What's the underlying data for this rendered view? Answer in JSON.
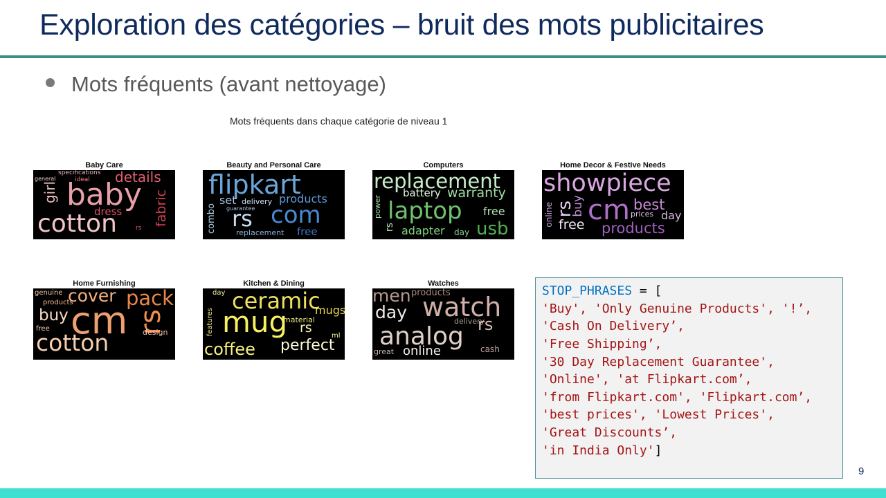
{
  "slide": {
    "title": "Exploration des catégories – bruit des mots publicitaires",
    "bullet": "Mots fréquents (avant nettoyage)",
    "figure_title": "Mots fréquents dans chaque catégorie de niveau 1",
    "page_number": "9"
  },
  "categories": [
    {
      "label": "Baby Care",
      "words": [
        "baby",
        "cotton",
        "details",
        "girl",
        "fabric",
        "dress",
        "specifications",
        "ideal",
        "general",
        "rs"
      ]
    },
    {
      "label": "Beauty and Personal Care",
      "words": [
        "flipkart",
        "rs",
        "com",
        "products",
        "set",
        "delivery",
        "guarantee",
        "combo",
        "replacement",
        "free"
      ]
    },
    {
      "label": "Computers",
      "words": [
        "replacement",
        "laptop",
        "battery",
        "warranty",
        "free",
        "usb",
        "adapter",
        "day",
        "power",
        "rs"
      ]
    },
    {
      "label": "Home Decor & Festive Needs",
      "words": [
        "showpiece",
        "cm",
        "rs",
        "buy",
        "online",
        "best",
        "prices",
        "day",
        "free",
        "products"
      ]
    },
    {
      "label": "Home Furnishing",
      "words": [
        "cm",
        "cover",
        "pack",
        "cotton",
        "buy",
        "rs",
        "genuine",
        "products",
        "free",
        "design"
      ]
    },
    {
      "label": "Kitchen & Dining",
      "words": [
        "ceramic",
        "mug",
        "coffee",
        "mugs",
        "material",
        "rs",
        "perfect",
        "features",
        "day",
        "ml"
      ]
    },
    {
      "label": "Watches",
      "words": [
        "watch",
        "analog",
        "men",
        "day",
        "products",
        "delivery",
        "rs",
        "online",
        "great",
        "cash"
      ]
    }
  ],
  "code": {
    "var_name": "STOP_PHRASES",
    "assign": " = [",
    "lines": [
      "'Buy', 'Only Genuine Products', '!’,",
      "'Cash On Delivery’,",
      "'Free Shipping’,",
      "'30 Day Replacement Guarantee',",
      "'Online', 'at Flipkart.com’,",
      "'from Flipkart.com', 'Flipkart.com’,",
      "'best prices', 'Lowest Prices',",
      "'Great Discounts’,",
      "'in India Only'"
    ],
    "close": "]"
  },
  "colors": {
    "title": "#0f2a5c",
    "rule": "#3a8f8a",
    "footer": "#40e0d0",
    "code_string": "#a31515",
    "code_keyword": "#0070c0"
  }
}
